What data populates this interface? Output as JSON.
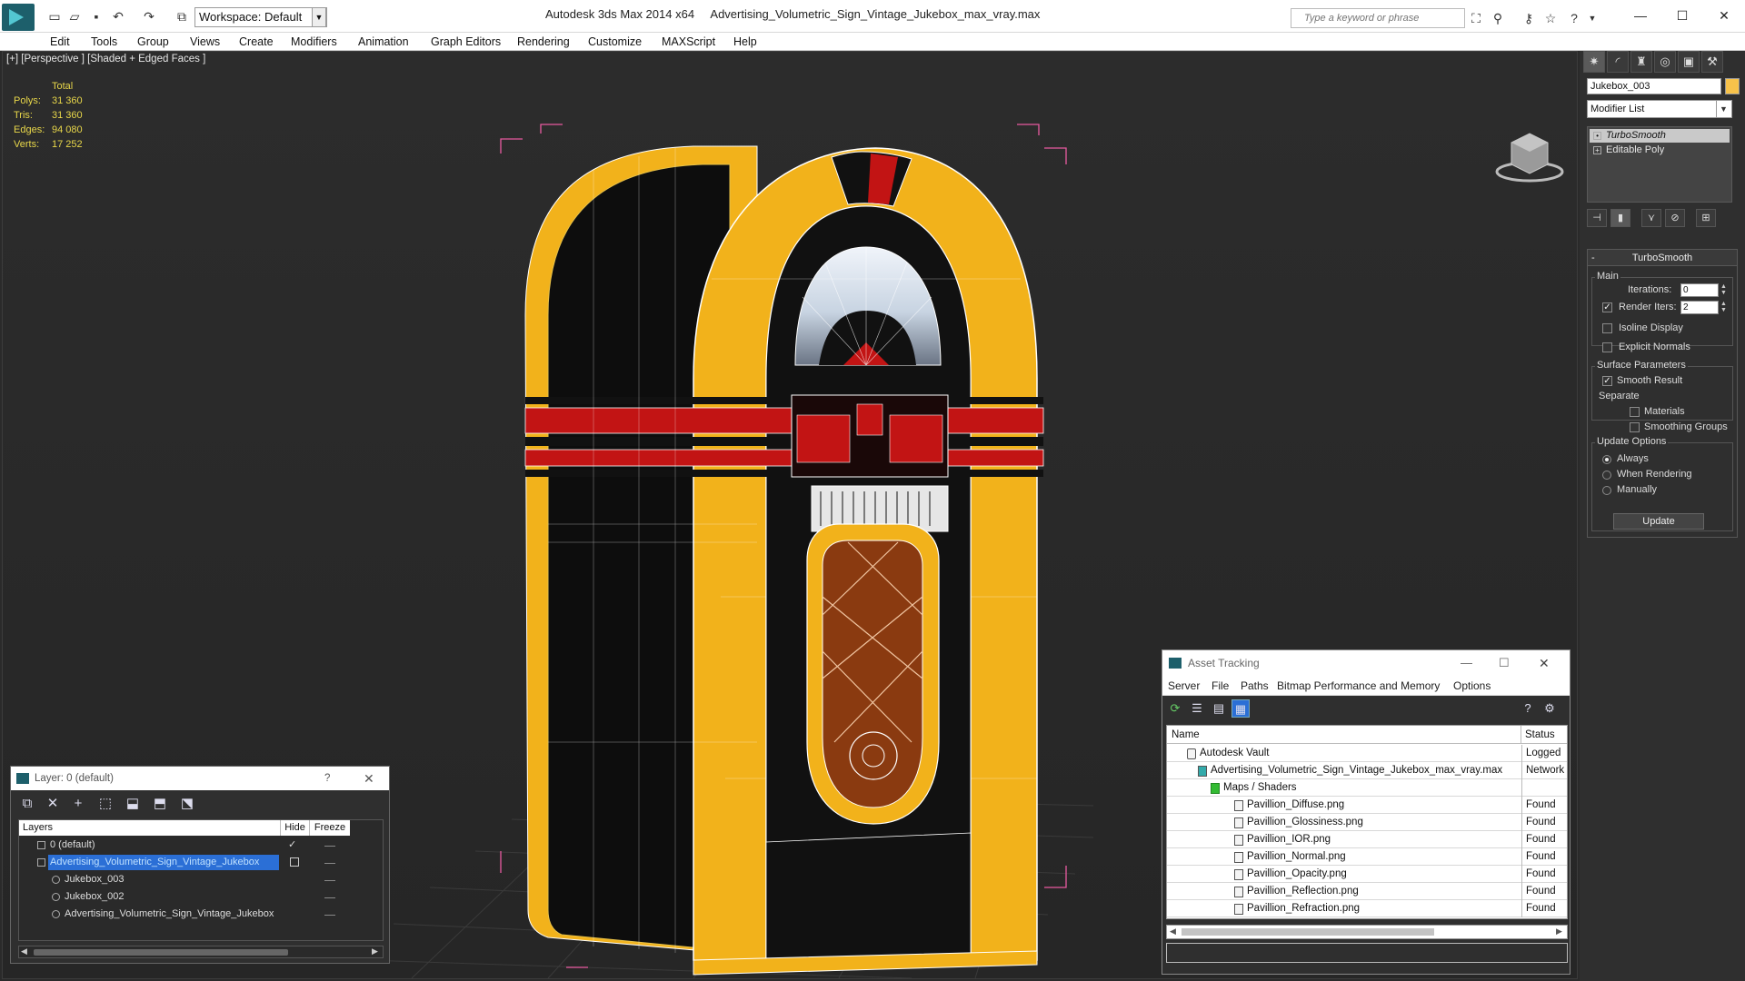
{
  "titlebar": {
    "workspace": "Workspace: Default",
    "title_app": "Autodesk 3ds Max  2014 x64",
    "title_file": "Advertising_Volumetric_Sign_Vintage_Jukebox_max_vray.max",
    "search_placeholder": "Type a keyword or phrase"
  },
  "menu": [
    "Edit",
    "Tools",
    "Group",
    "Views",
    "Create",
    "Modifiers",
    "Animation",
    "Graph Editors",
    "Rendering",
    "Customize",
    "MAXScript",
    "Help"
  ],
  "viewport": {
    "label": "[+] [Perspective ] [Shaded + Edged Faces ]",
    "stats_header": "Total",
    "stats": [
      {
        "label": "Polys:",
        "value": "31 360"
      },
      {
        "label": "Tris:",
        "value": "31 360"
      },
      {
        "label": "Edges:",
        "value": "94 080"
      },
      {
        "label": "Verts:",
        "value": "17 252"
      }
    ]
  },
  "command_panel": {
    "object_name": "Jukebox_003",
    "object_color": "#f7c24a",
    "modifier_list": "Modifier List",
    "stack": [
      "TurboSmooth",
      "Editable Poly"
    ],
    "rollout_title": "TurboSmooth",
    "main_label": "Main",
    "iterations_label": "Iterations:",
    "iterations_value": "0",
    "render_iters_label": "Render Iters:",
    "render_iters_value": "2",
    "isoline_display": "Isoline Display",
    "explicit_normals": "Explicit Normals",
    "surface_params": "Surface Parameters",
    "smooth_result": "Smooth Result",
    "separate": "Separate",
    "materials": "Materials",
    "smoothing_groups": "Smoothing Groups",
    "update_options": "Update Options",
    "always": "Always",
    "when_rendering": "When Rendering",
    "manually": "Manually",
    "update": "Update"
  },
  "layer_window": {
    "title": "Layer: 0 (default)",
    "help": "?",
    "col_layers": "Layers",
    "col_hide": "Hide",
    "col_freeze": "Freeze",
    "rows": [
      {
        "name": "0 (default)"
      },
      {
        "name": "Advertising_Volumetric_Sign_Vintage_Jukebox"
      },
      {
        "name": "Jukebox_003"
      },
      {
        "name": "Jukebox_002"
      },
      {
        "name": "Advertising_Volumetric_Sign_Vintage_Jukebox"
      }
    ]
  },
  "asset_tracking": {
    "title": "Asset Tracking",
    "menu": [
      "Server",
      "File",
      "Paths",
      "Bitmap Performance and Memory",
      "Options"
    ],
    "col_name": "Name",
    "col_status": "Status",
    "rows": [
      {
        "name": "Autodesk Vault",
        "status": "Logged"
      },
      {
        "name": "Advertising_Volumetric_Sign_Vintage_Jukebox_max_vray.max",
        "status": "Network"
      },
      {
        "name": "Maps / Shaders",
        "status": ""
      },
      {
        "name": "Pavillion_Diffuse.png",
        "status": "Found"
      },
      {
        "name": "Pavillion_Glossiness.png",
        "status": "Found"
      },
      {
        "name": "Pavillion_IOR.png",
        "status": "Found"
      },
      {
        "name": "Pavillion_Normal.png",
        "status": "Found"
      },
      {
        "name": "Pavillion_Opacity.png",
        "status": "Found"
      },
      {
        "name": "Pavillion_Reflection.png",
        "status": "Found"
      },
      {
        "name": "Pavillion_Refraction.png",
        "status": "Found"
      }
    ]
  },
  "colors": {
    "jukebox_yellow": "#f2b21b",
    "jukebox_red": "#c21414",
    "wood_brown": "#8a3a10",
    "bbox_pink": "#e85aa0",
    "stat_yellow": "#e8d74a",
    "selection_blue": "#2b6fd6"
  }
}
